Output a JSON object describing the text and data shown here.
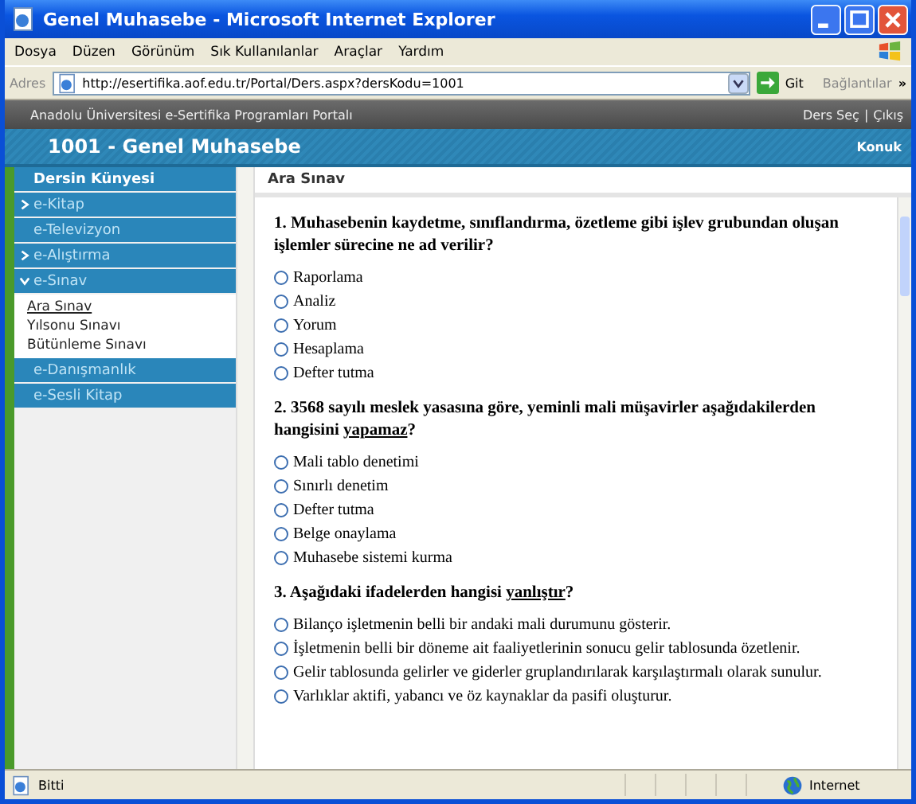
{
  "window": {
    "title": "Genel Muhasebe - Microsoft Internet Explorer"
  },
  "menu": [
    "Dosya",
    "Düzen",
    "Görünüm",
    "Sık Kullanılanlar",
    "Araçlar",
    "Yardım"
  ],
  "address_bar": {
    "label": "Adres",
    "url": "http://esertifika.aof.edu.tr/Portal/Ders.aspx?dersKodu=1001",
    "go": "Git",
    "links": "Bağlantılar",
    "more": "»"
  },
  "portal_bar": {
    "title": "Anadolu Üniversitesi e-Sertifika Programları Portalı",
    "links": [
      "Ders Seç",
      "Çıkış"
    ],
    "separator": "|"
  },
  "course_header": {
    "title": "1001 - Genel Muhasebe",
    "user": "Konuk"
  },
  "sidebar": {
    "items": [
      {
        "kind": "heading",
        "label": "Dersin Künyesi"
      },
      {
        "kind": "menu",
        "label": "e-Kitap",
        "expanded": false
      },
      {
        "kind": "menu",
        "label": "e-Televizyon"
      },
      {
        "kind": "menu",
        "label": "e-Alıştırma",
        "expanded": false
      },
      {
        "kind": "menu",
        "label": "e-Sınav",
        "expanded": true,
        "children": [
          {
            "label": "Ara Sınav",
            "selected": true
          },
          {
            "label": "Yılsonu Sınavı",
            "selected": false
          },
          {
            "label": "Bütünleme Sınavı",
            "selected": false
          }
        ]
      },
      {
        "kind": "menu",
        "label": "e-Danışmanlık"
      },
      {
        "kind": "menu",
        "label": "e-Sesli Kitap"
      }
    ]
  },
  "content": {
    "title": "Ara Sınav",
    "questions": [
      {
        "parts": [
          {
            "text": "1. Muhasebenin kaydetme, sınıflandırma, özetleme gibi işlev grubundan oluşan işlemler sürecine ne ad verilir?",
            "underlined": false
          }
        ],
        "options": [
          {
            "text": "Raporlama",
            "selected": false
          },
          {
            "text": "Analiz",
            "selected": false
          },
          {
            "text": "Yorum",
            "selected": false
          },
          {
            "text": "Hesaplama",
            "selected": false
          },
          {
            "text": "Defter tutma",
            "selected": false
          }
        ]
      },
      {
        "parts": [
          {
            "text": "2. 3568 sayılı meslek yasasına göre, yeminli mali müşavirler aşağıdakilerden hangisini ",
            "underlined": false
          },
          {
            "text": "yapamaz",
            "underlined": true
          },
          {
            "text": "?",
            "underlined": false
          }
        ],
        "options": [
          {
            "text": "Mali tablo denetimi",
            "selected": false
          },
          {
            "text": "Sınırlı denetim",
            "selected": false
          },
          {
            "text": "Defter tutma",
            "selected": false
          },
          {
            "text": "Belge onaylama",
            "selected": false
          },
          {
            "text": "Muhasebe sistemi kurma",
            "selected": false
          }
        ]
      },
      {
        "parts": [
          {
            "text": "3. Aşağıdaki ifadelerden hangisi ",
            "underlined": false
          },
          {
            "text": "yanlıştır",
            "underlined": true
          },
          {
            "text": "?",
            "underlined": false
          }
        ],
        "options": [
          {
            "text": "Bilanço işletmenin belli bir andaki mali durumunu gösterir.",
            "selected": false
          },
          {
            "text": "İşletmenin belli bir döneme ait faaliyetlerinin sonucu gelir tablosunda özetlenir.",
            "selected": false
          },
          {
            "text": "Gelir tablosunda gelirler ve giderler gruplandırılarak karşılaştırmalı olarak sunulur.",
            "selected": false
          },
          {
            "text": "Varlıklar aktifi, yabancı ve öz kaynaklar da pasifi oluşturur.",
            "selected": false
          }
        ]
      }
    ]
  },
  "status_bar": {
    "text": "Bitti",
    "zone": "Internet"
  }
}
